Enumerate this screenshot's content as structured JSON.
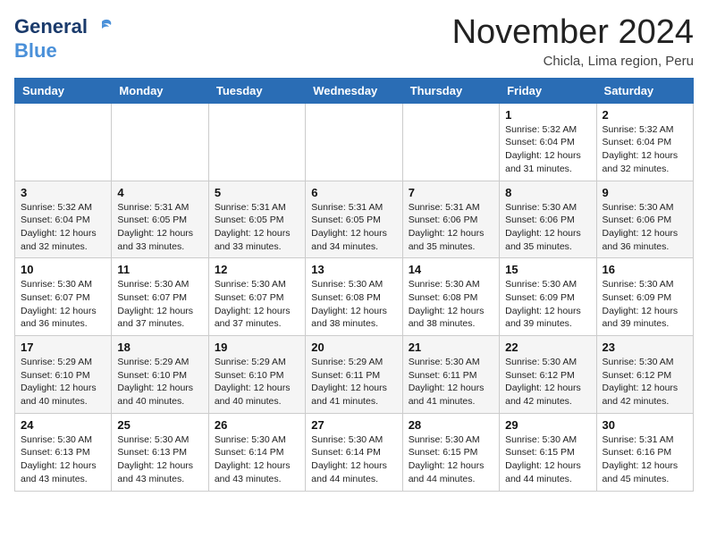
{
  "logo": {
    "line1": "General",
    "line2": "Blue"
  },
  "title": "November 2024",
  "subtitle": "Chicla, Lima region, Peru",
  "days_of_week": [
    "Sunday",
    "Monday",
    "Tuesday",
    "Wednesday",
    "Thursday",
    "Friday",
    "Saturday"
  ],
  "weeks": [
    [
      {
        "day": "",
        "info": ""
      },
      {
        "day": "",
        "info": ""
      },
      {
        "day": "",
        "info": ""
      },
      {
        "day": "",
        "info": ""
      },
      {
        "day": "",
        "info": ""
      },
      {
        "day": "1",
        "info": "Sunrise: 5:32 AM\nSunset: 6:04 PM\nDaylight: 12 hours\nand 31 minutes."
      },
      {
        "day": "2",
        "info": "Sunrise: 5:32 AM\nSunset: 6:04 PM\nDaylight: 12 hours\nand 32 minutes."
      }
    ],
    [
      {
        "day": "3",
        "info": "Sunrise: 5:32 AM\nSunset: 6:04 PM\nDaylight: 12 hours\nand 32 minutes."
      },
      {
        "day": "4",
        "info": "Sunrise: 5:31 AM\nSunset: 6:05 PM\nDaylight: 12 hours\nand 33 minutes."
      },
      {
        "day": "5",
        "info": "Sunrise: 5:31 AM\nSunset: 6:05 PM\nDaylight: 12 hours\nand 33 minutes."
      },
      {
        "day": "6",
        "info": "Sunrise: 5:31 AM\nSunset: 6:05 PM\nDaylight: 12 hours\nand 34 minutes."
      },
      {
        "day": "7",
        "info": "Sunrise: 5:31 AM\nSunset: 6:06 PM\nDaylight: 12 hours\nand 35 minutes."
      },
      {
        "day": "8",
        "info": "Sunrise: 5:30 AM\nSunset: 6:06 PM\nDaylight: 12 hours\nand 35 minutes."
      },
      {
        "day": "9",
        "info": "Sunrise: 5:30 AM\nSunset: 6:06 PM\nDaylight: 12 hours\nand 36 minutes."
      }
    ],
    [
      {
        "day": "10",
        "info": "Sunrise: 5:30 AM\nSunset: 6:07 PM\nDaylight: 12 hours\nand 36 minutes."
      },
      {
        "day": "11",
        "info": "Sunrise: 5:30 AM\nSunset: 6:07 PM\nDaylight: 12 hours\nand 37 minutes."
      },
      {
        "day": "12",
        "info": "Sunrise: 5:30 AM\nSunset: 6:07 PM\nDaylight: 12 hours\nand 37 minutes."
      },
      {
        "day": "13",
        "info": "Sunrise: 5:30 AM\nSunset: 6:08 PM\nDaylight: 12 hours\nand 38 minutes."
      },
      {
        "day": "14",
        "info": "Sunrise: 5:30 AM\nSunset: 6:08 PM\nDaylight: 12 hours\nand 38 minutes."
      },
      {
        "day": "15",
        "info": "Sunrise: 5:30 AM\nSunset: 6:09 PM\nDaylight: 12 hours\nand 39 minutes."
      },
      {
        "day": "16",
        "info": "Sunrise: 5:30 AM\nSunset: 6:09 PM\nDaylight: 12 hours\nand 39 minutes."
      }
    ],
    [
      {
        "day": "17",
        "info": "Sunrise: 5:29 AM\nSunset: 6:10 PM\nDaylight: 12 hours\nand 40 minutes."
      },
      {
        "day": "18",
        "info": "Sunrise: 5:29 AM\nSunset: 6:10 PM\nDaylight: 12 hours\nand 40 minutes."
      },
      {
        "day": "19",
        "info": "Sunrise: 5:29 AM\nSunset: 6:10 PM\nDaylight: 12 hours\nand 40 minutes."
      },
      {
        "day": "20",
        "info": "Sunrise: 5:29 AM\nSunset: 6:11 PM\nDaylight: 12 hours\nand 41 minutes."
      },
      {
        "day": "21",
        "info": "Sunrise: 5:30 AM\nSunset: 6:11 PM\nDaylight: 12 hours\nand 41 minutes."
      },
      {
        "day": "22",
        "info": "Sunrise: 5:30 AM\nSunset: 6:12 PM\nDaylight: 12 hours\nand 42 minutes."
      },
      {
        "day": "23",
        "info": "Sunrise: 5:30 AM\nSunset: 6:12 PM\nDaylight: 12 hours\nand 42 minutes."
      }
    ],
    [
      {
        "day": "24",
        "info": "Sunrise: 5:30 AM\nSunset: 6:13 PM\nDaylight: 12 hours\nand 43 minutes."
      },
      {
        "day": "25",
        "info": "Sunrise: 5:30 AM\nSunset: 6:13 PM\nDaylight: 12 hours\nand 43 minutes."
      },
      {
        "day": "26",
        "info": "Sunrise: 5:30 AM\nSunset: 6:14 PM\nDaylight: 12 hours\nand 43 minutes."
      },
      {
        "day": "27",
        "info": "Sunrise: 5:30 AM\nSunset: 6:14 PM\nDaylight: 12 hours\nand 44 minutes."
      },
      {
        "day": "28",
        "info": "Sunrise: 5:30 AM\nSunset: 6:15 PM\nDaylight: 12 hours\nand 44 minutes."
      },
      {
        "day": "29",
        "info": "Sunrise: 5:30 AM\nSunset: 6:15 PM\nDaylight: 12 hours\nand 44 minutes."
      },
      {
        "day": "30",
        "info": "Sunrise: 5:31 AM\nSunset: 6:16 PM\nDaylight: 12 hours\nand 45 minutes."
      }
    ]
  ]
}
